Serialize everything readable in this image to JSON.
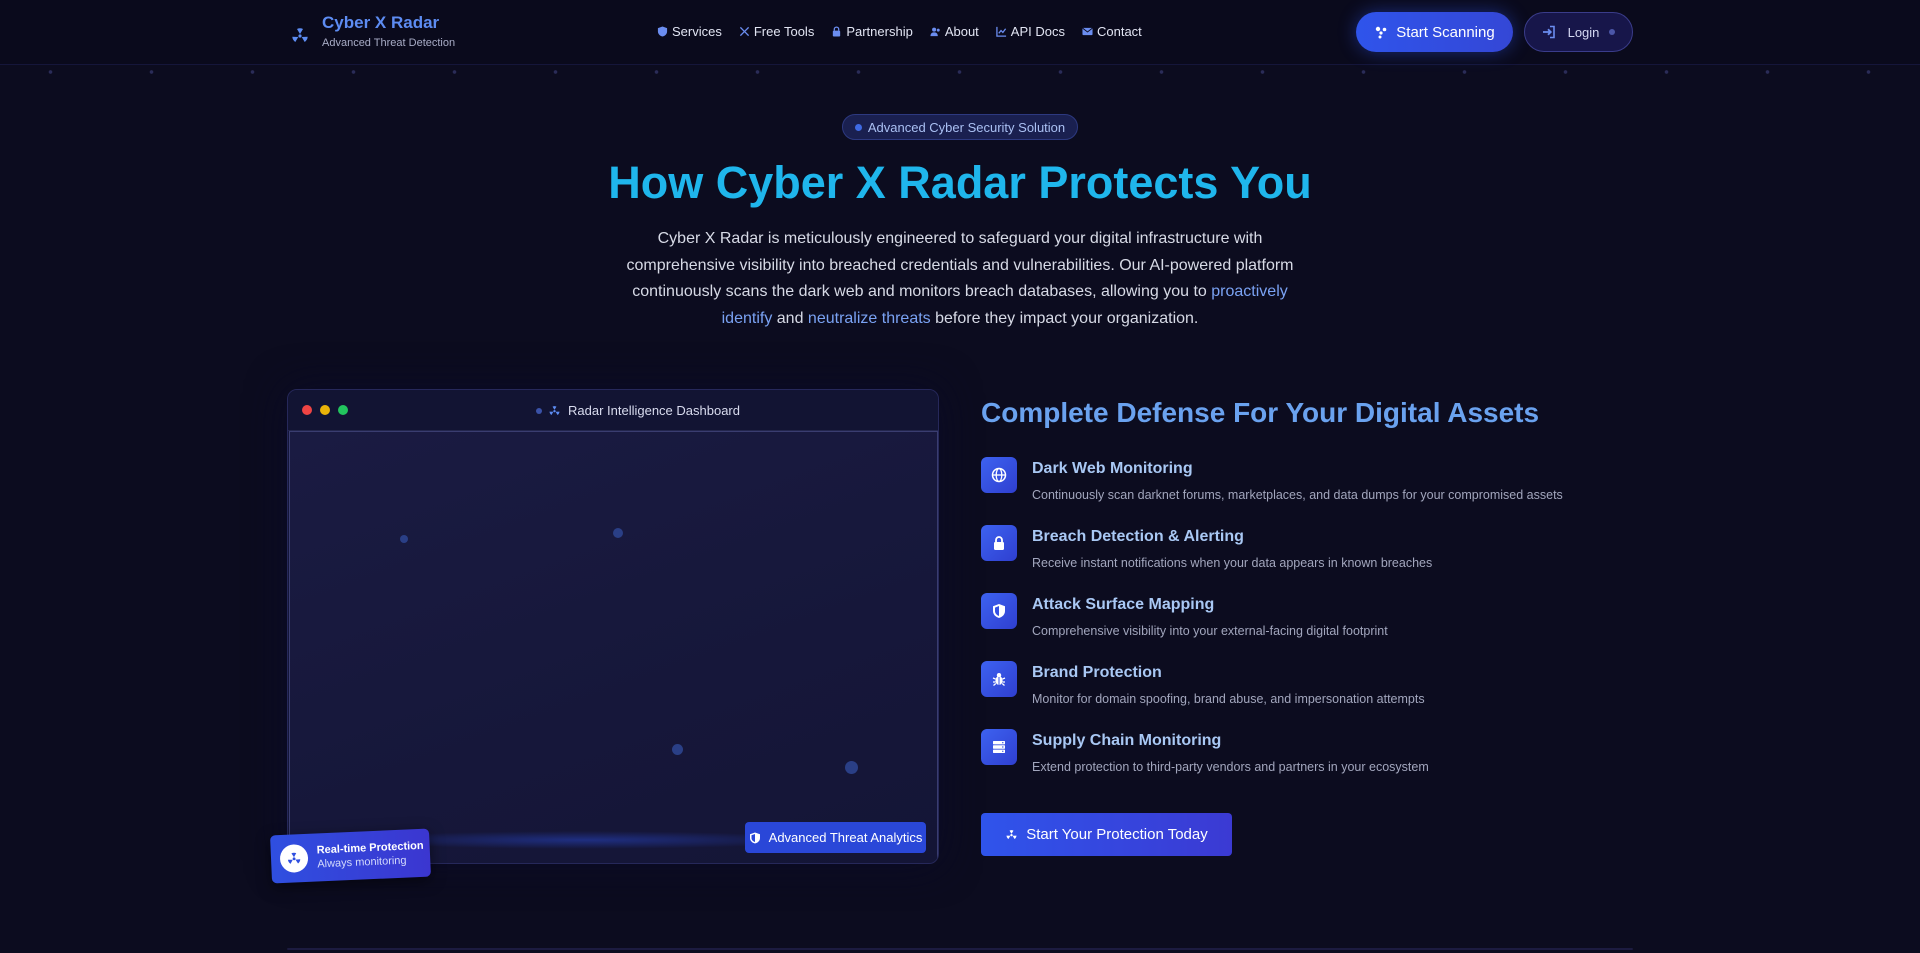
{
  "nav": {
    "brand_name": "Cyber X Radar",
    "brand_tagline": "Advanced Threat Detection",
    "links": [
      {
        "label": "Services",
        "icon": "shield-icon"
      },
      {
        "label": "Free Tools",
        "icon": "tools-icon"
      },
      {
        "label": "Partnership",
        "icon": "lock-icon"
      },
      {
        "label": "About",
        "icon": "users-icon"
      },
      {
        "label": "API Docs",
        "icon": "chart-icon"
      },
      {
        "label": "Contact",
        "icon": "envelope-icon"
      }
    ],
    "start_scanning": "Start Scanning",
    "login": "Login"
  },
  "hero": {
    "badge": "Advanced Cyber Security Solution",
    "title": "How Cyber X Radar Protects You",
    "desc_part1": "Cyber X Radar is meticulously engineered to safeguard your digital infrastructure with comprehensive visibility into breached credentials and vulnerabilities. Our AI-powered platform continuously scans the dark web and monitors breach databases, allowing you to ",
    "desc_highlight1": "proactively identify",
    "desc_part2": " and ",
    "desc_highlight2": "neutralize threats",
    "desc_part3": " before they impact your organization."
  },
  "dashboard": {
    "title": "Radar Intelligence Dashboard",
    "analytics_button": "Advanced Threat Analytics",
    "badge_title": "Real-time Protection",
    "badge_subtitle": "Always monitoring"
  },
  "features": {
    "title": "Complete Defense For Your Digital Assets",
    "items": [
      {
        "title": "Dark Web Monitoring",
        "desc": "Continuously scan darknet forums, marketplaces, and data dumps for your compromised assets",
        "icon": "globe-icon"
      },
      {
        "title": "Breach Detection & Alerting",
        "desc": "Receive instant notifications when your data appears in known breaches",
        "icon": "lock-icon"
      },
      {
        "title": "Attack Surface Mapping",
        "desc": "Comprehensive visibility into your external-facing digital footprint",
        "icon": "shield-icon"
      },
      {
        "title": "Brand Protection",
        "desc": "Monitor for domain spoofing, brand abuse, and impersonation attempts",
        "icon": "bug-icon"
      },
      {
        "title": "Supply Chain Monitoring",
        "desc": "Extend protection to third-party vendors and partners in your ecosystem",
        "icon": "server-icon"
      }
    ],
    "cta": "Start Your Protection Today"
  },
  "colors": {
    "background": "#0c0c1f",
    "accent": "#2f54eb",
    "title": "#1fb6ec",
    "highlight": "#7aa2f3"
  }
}
